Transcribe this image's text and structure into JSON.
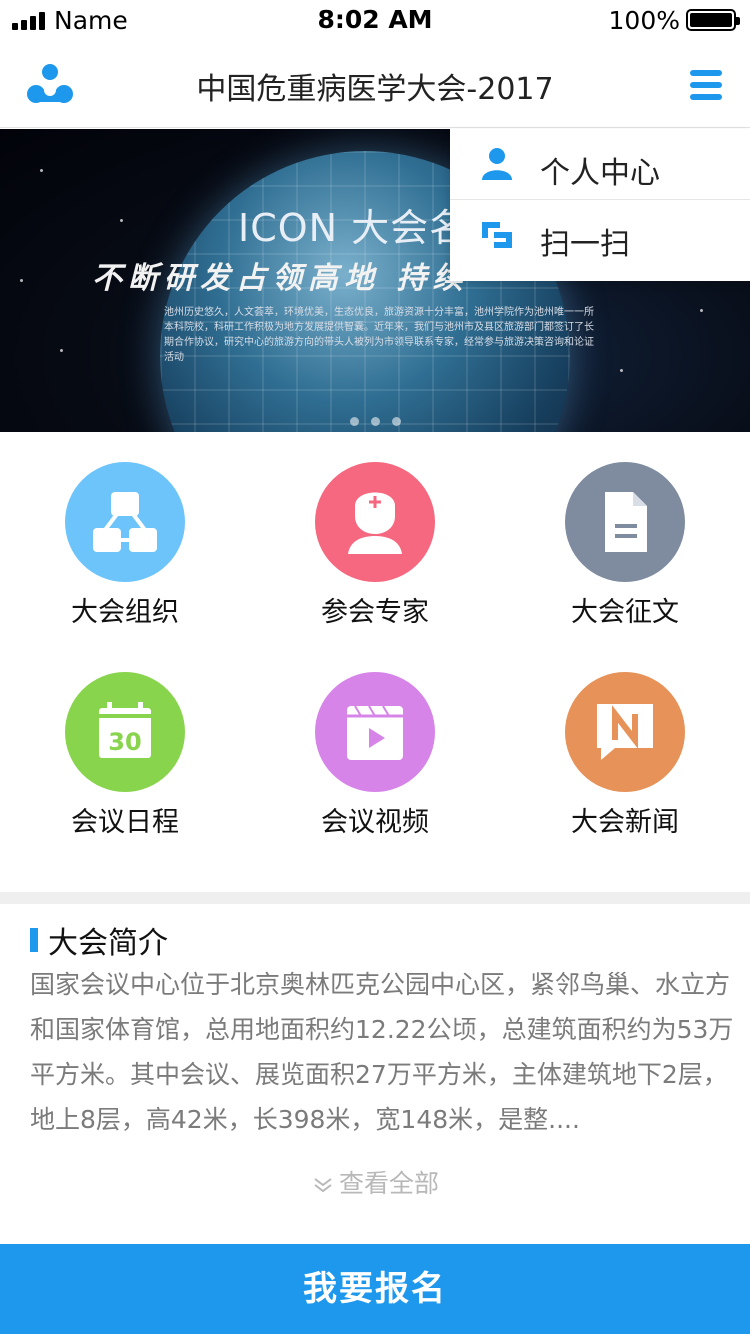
{
  "status_bar": {
    "carrier": "Name",
    "time": "8:02 AM",
    "battery": "100%"
  },
  "nav": {
    "title": "中国危重病医学大会-2017",
    "logo_icon": "people-logo-icon",
    "menu_icon": "hamburger-menu-icon"
  },
  "banner": {
    "heading": "ICON 大会名",
    "slogan": "不断研发占领高地   持续",
    "description": "池州历史悠久，人文荟萃，环境优美，生态优良，旅游资源十分丰富，池州学院作为池州唯一一所本科院校，科研工作积极为地方发展提供智囊。近年来，我们与池州市及县区旅游部门都签订了长期合作协议，研究中心的旅游方向的带头人被列为市领导联系专家，经常参与旅游决策咨询和论证活动",
    "dots": 3
  },
  "dropdown": {
    "items": [
      {
        "label": "个人中心",
        "icon": "user-icon"
      },
      {
        "label": "扫一扫",
        "icon": "scan-icon"
      }
    ]
  },
  "grid": {
    "items": [
      {
        "label": "大会组织",
        "icon": "organization-icon",
        "color": "#6cc4fb"
      },
      {
        "label": "参会专家",
        "icon": "doctor-icon",
        "color": "#f5687f"
      },
      {
        "label": "大会征文",
        "icon": "document-icon",
        "color": "#7f8ca0"
      },
      {
        "label": "会议日程",
        "icon": "calendar-icon",
        "calendar_day": "30",
        "color": "#89d44d"
      },
      {
        "label": "会议视频",
        "icon": "video-icon",
        "color": "#d684e8"
      },
      {
        "label": "大会新闻",
        "icon": "news-icon",
        "color": "#e69259"
      }
    ]
  },
  "intro": {
    "title": "大会简介",
    "body": "国家会议中心位于北京奥林匹克公园中心区，紧邻鸟巢、水立方和国家体育馆，总用地面积约12.22公顷，总建筑面积约为53万平方米。其中会议、展览面积27万平方米，主体建筑地下2层，地上8层，高42米，长398米，宽148米，是整....",
    "view_all": "查看全部"
  },
  "register": {
    "label": "我要报名"
  },
  "colors": {
    "accent": "#1e98ec"
  }
}
